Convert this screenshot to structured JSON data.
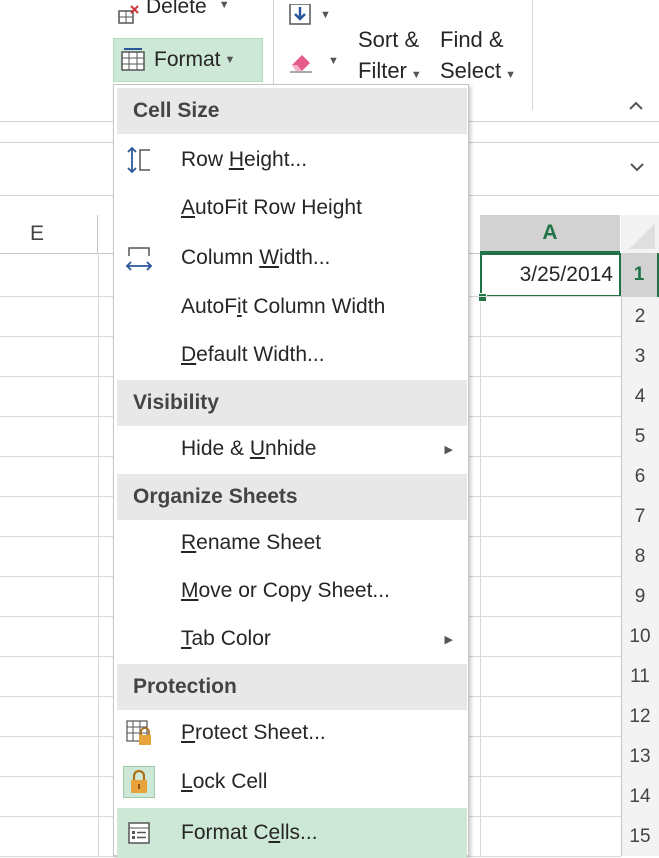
{
  "ribbon": {
    "delete_label": "Delete",
    "format_label": "Format",
    "sort_filter_line1": "Sort &",
    "sort_filter_line2": "Filter",
    "find_select_line1": "Find &",
    "find_select_line2": "Select",
    "icons": [
      "delete-cells-icon",
      "format-cells-icon",
      "fill-icon",
      "clear-eraser-icon",
      "collapse-ribbon-icon"
    ]
  },
  "formula_bar": {
    "expand_icon": "chevron-down-icon"
  },
  "grid": {
    "column_e": "E",
    "column_a": "A",
    "active_cell_value": "3/25/2014",
    "row_numbers": [
      "1",
      "2",
      "3",
      "4",
      "5",
      "6",
      "7",
      "8",
      "9",
      "10",
      "11",
      "12",
      "13",
      "14",
      "15"
    ]
  },
  "menu": {
    "sections": {
      "cell_size": "Cell Size",
      "visibility": "Visibility",
      "organize": "Organize Sheets",
      "protection": "Protection"
    },
    "items": {
      "row_height": "Row Height...",
      "autofit_row": "AutoFit Row Height",
      "column_width": "Column Width...",
      "autofit_col": "AutoFit Column Width",
      "default_width": "Default Width...",
      "hide_unhide": "Hide & Unhide",
      "rename": "Rename Sheet",
      "move_copy": "Move or Copy Sheet...",
      "tab_color": "Tab Color",
      "protect": "Protect Sheet...",
      "lock": "Lock Cell",
      "format_cells": "Format Cells..."
    },
    "highlighted": "Format Cells..."
  },
  "colors": {
    "accent_green": "#217346",
    "highlight_green": "#cde8d6",
    "header_gray": "#e8e8e8"
  }
}
